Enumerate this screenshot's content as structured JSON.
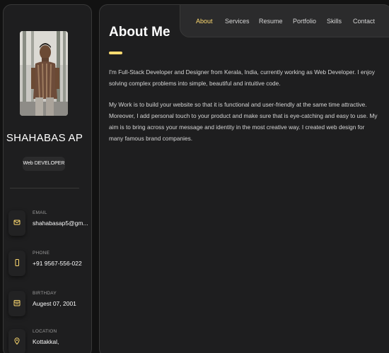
{
  "sidebar": {
    "name": "SHAHABAS AP",
    "title": "Web DEVELOPER",
    "contacts": [
      {
        "label": "EMAIL",
        "value": "shahabasap5@gm...",
        "icon": "mail-icon"
      },
      {
        "label": "PHONE",
        "value": "+91 9567-556-022",
        "icon": "phone-icon"
      },
      {
        "label": "BIRTHDAY",
        "value": "Augest 07, 2001",
        "icon": "calendar-icon"
      },
      {
        "label": "LOCATION",
        "value": "Kottakkal,",
        "icon": "location-pin-icon"
      }
    ]
  },
  "navbar": {
    "items": [
      "About",
      "Services",
      "Resume",
      "Portfolio",
      "Skills",
      "Contact"
    ],
    "active": "About"
  },
  "about": {
    "title": "About Me",
    "paragraphs": [
      "I'm Full-Stack Developer and Designer from Kerala, India, currently working as Web Developer. I enjoy solving complex problems into simple, beautiful and intuitive code.",
      "My Work is to build your website so that it is functional and user-friendly at the same time attractive. Moreover, I add personal touch to your product and make sure that is eye-catching and easy to use. My aim is to bring across your message and identity in the most creative way. I created web design for many famous brand companies."
    ]
  },
  "colors": {
    "accent": "#ffdb70",
    "background": "#121212",
    "panel": "#1e1e1f"
  }
}
